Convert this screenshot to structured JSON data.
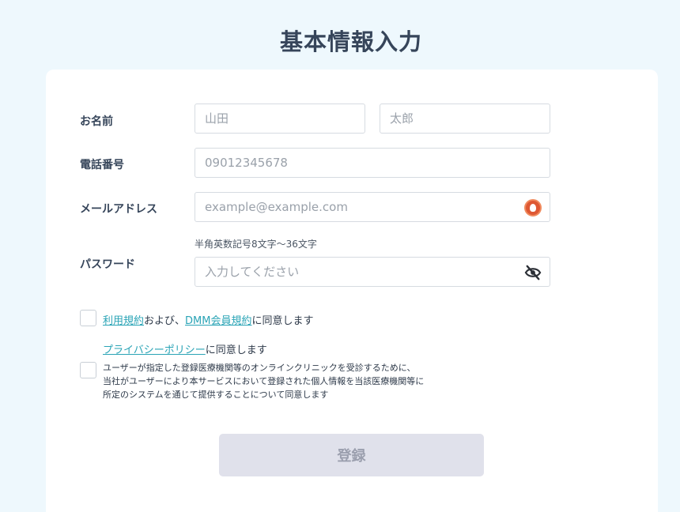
{
  "page": {
    "title": "基本情報入力"
  },
  "form": {
    "name": {
      "label": "お名前",
      "last_placeholder": "山田",
      "first_placeholder": "太郎"
    },
    "phone": {
      "label": "電話番号",
      "placeholder": "09012345678"
    },
    "email": {
      "label": "メールアドレス",
      "placeholder": "example@example.com",
      "autofill_icon": "duckduckgo-icon"
    },
    "password": {
      "label": "パスワード",
      "hint": "半角英数記号8文字〜36文字",
      "placeholder": "入力してください",
      "toggle_icon": "eye-slash-icon"
    },
    "agreements": {
      "terms_link": "利用規約",
      "terms_middle": "および、",
      "dmm_link": "DMM会員規約",
      "terms_suffix": "に同意します",
      "privacy_link": "プライバシーポリシー",
      "privacy_suffix": "に同意します",
      "consent_line1": "ユーザーが指定した登録医療機関等のオンラインクリニックを受診するために、",
      "consent_line2": "当社がユーザーにより本サービスにおいて登録された個人情報を当該医療機関等に",
      "consent_line3": "所定のシステムを通じて提供することについて同意します"
    },
    "submit_label": "登録"
  },
  "colors": {
    "background": "#eef8fd",
    "link": "#2aa4b6",
    "button_disabled": "#e0e1eb"
  }
}
